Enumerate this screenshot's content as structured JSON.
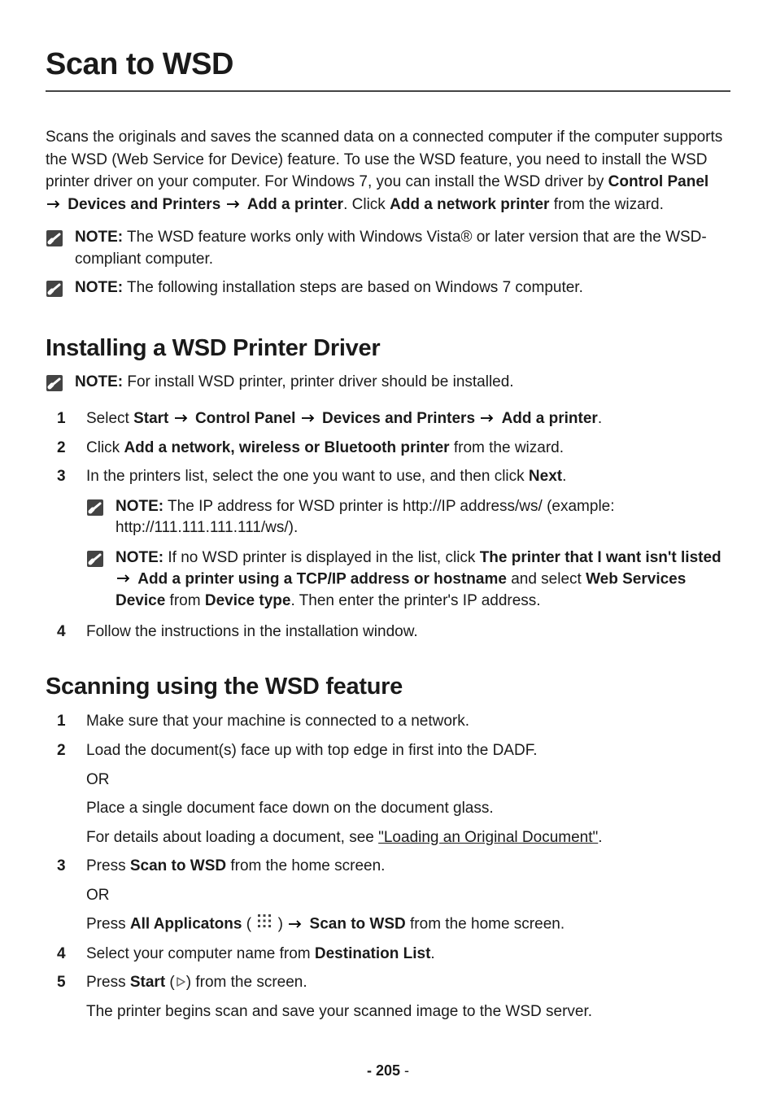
{
  "title": "Scan to WSD",
  "intro_parts": {
    "p1": "Scans the originals and saves the scanned data on a connected computer if the computer supports the WSD (Web Service for Device) feature. To use the WSD feature, you need to install the WSD printer driver on your computer. For Windows 7, you can install the WSD driver by ",
    "b1": "Control Panel",
    "b2": " Devices and Printers",
    "b3": " Add a printer",
    "p2": ". Click ",
    "b4": "Add a network printer",
    "p3": " from the wizard."
  },
  "note1": {
    "label": "NOTE:",
    "text": " The WSD feature works only with Windows Vista® or later version that are the WSD-compliant computer."
  },
  "note2": {
    "label": "NOTE:",
    "text": " The following installation steps are based on Windows 7 computer."
  },
  "section1": {
    "heading": "Installing a WSD Printer Driver",
    "note": {
      "label": "NOTE:",
      "text": " For install WSD printer, printer driver should be installed."
    },
    "steps": {
      "s1_a": "Select ",
      "s1_b1": "Start",
      "s1_b2": " Control Panel",
      "s1_b3": " Devices and Printers",
      "s1_b4": " Add a printer",
      "s1_end": ".",
      "s2_a": "Click ",
      "s2_b": "Add a network, wireless or Bluetooth printer",
      "s2_end": " from the wizard.",
      "s3_a": "In the printers list, select the one you want to use, and then click ",
      "s3_b": "Next",
      "s3_end": ".",
      "s3_note1": {
        "label": "NOTE:",
        "text": " The IP address for WSD printer is http://IP address/ws/ (example: http://111.111.111.111/ws/)."
      },
      "s3_note2": {
        "label": "NOTE:",
        "a": " If no WSD printer is displayed in the list, click ",
        "b1": "The printer that I want isn't listed",
        "b2": " Add a printer using a TCP/IP address or hostname",
        "mid": " and select ",
        "b3": "Web Services Device",
        "mid2": " from ",
        "b4": "Device type",
        "end": ". Then enter the printer's IP address."
      },
      "s4": "Follow the instructions in the installation window."
    }
  },
  "section2": {
    "heading": "Scanning using the WSD feature",
    "steps": {
      "s1": "Make sure that your machine is connected to a network.",
      "s2_a": "Load the document(s) face up with top edge in first into the DADF.",
      "s2_or": "OR",
      "s2_b": "Place a single document face down on the document glass.",
      "s2_c": "For details about loading a document, see ",
      "s2_link": "\"Loading an Original Document\"",
      "s2_end": ".",
      "s3_a": "Press ",
      "s3_b1": "Scan to WSD",
      "s3_mid": " from the home screen.",
      "s3_or": "OR",
      "s3_c": "Press ",
      "s3_b2": "All Applicatons",
      "s3_open": " ( ",
      "s3_close": " ) ",
      "s3_b3": " Scan to WSD",
      "s3_end": " from the home screen.",
      "s4_a": "Select your computer name from ",
      "s4_b": "Destination List",
      "s4_end": ".",
      "s5_a": "Press ",
      "s5_b": "Start",
      "s5_open": " (",
      "s5_close": ") from the screen.",
      "s5_end": "The printer begins scan and save your scanned image to the WSD server."
    }
  },
  "page_number": "205"
}
